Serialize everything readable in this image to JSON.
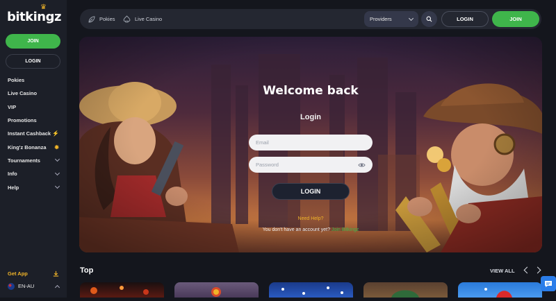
{
  "brand": {
    "logo_text": "bitkingz"
  },
  "sidebar": {
    "join_label": "JOIN",
    "login_label": "LOGIN",
    "items": [
      {
        "label": "Pokies",
        "icon": ""
      },
      {
        "label": "Live Casino",
        "icon": ""
      },
      {
        "label": "VIP",
        "icon": ""
      },
      {
        "label": "Promotions",
        "icon": ""
      },
      {
        "label": "Instant Cashback",
        "icon": "lightning-icon"
      },
      {
        "label": "King'z Bonanza",
        "icon": "sun-icon"
      },
      {
        "label": "Tournaments",
        "icon": "chevron-down-icon"
      },
      {
        "label": "Info",
        "icon": "chevron-down-icon"
      },
      {
        "label": "Help",
        "icon": "chevron-down-icon"
      }
    ],
    "get_app_label": "Get App",
    "language_label": "EN-AU"
  },
  "topbar": {
    "pokies_label": "Pokies",
    "live_casino_label": "Live Casino",
    "providers_label": "Providers",
    "login_label": "LOGIN",
    "join_label": "JOIN"
  },
  "hero": {
    "title": "Welcome back",
    "subtitle": "Login",
    "email_placeholder": "Email",
    "password_placeholder": "Password",
    "login_button": "LOGIN",
    "need_help": "Need Help?",
    "no_account_text": "You don't have an account yet?",
    "join_link": "Join Bitkingz"
  },
  "top_section": {
    "title": "Top",
    "view_all_label": "VIEW ALL"
  },
  "colors": {
    "accent_green": "#3fb54b",
    "accent_gold": "#f0b429",
    "background": "#14161d",
    "sidebar": "#1c1f28"
  }
}
